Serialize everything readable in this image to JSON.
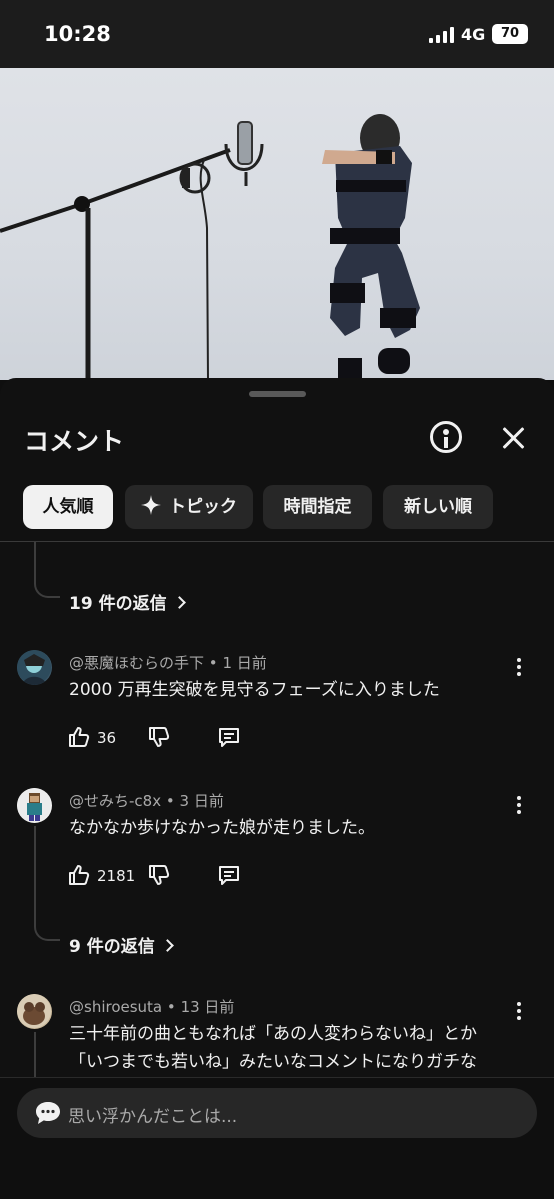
{
  "status_bar": {
    "time": "10:28",
    "network": "4G",
    "battery": "70"
  },
  "video": {
    "description_icon": "video-frame"
  },
  "comments_panel": {
    "title": "コメント",
    "chips": [
      {
        "label": "人気順",
        "selected": true
      },
      {
        "label": "トピック",
        "icon": "sparkle-icon",
        "selected": false
      },
      {
        "label": "時間指定",
        "selected": false
      },
      {
        "label": "新しい順",
        "selected": false
      }
    ],
    "top_replies_link": "19 件の返信",
    "comments": [
      {
        "author": "@悪魔ほむらの手下",
        "age": "1 日前",
        "text": "2000 万再生突破を見守るフェーズに入りました",
        "likes": "36"
      },
      {
        "author": "@せみち-c8x",
        "age": "3 日前",
        "text": "なかなか歩けなかった娘が走りました。",
        "likes": "2181",
        "replies": "9 件の返信"
      },
      {
        "author": "@shiroesuta",
        "age": "13 日前",
        "text_line1": "三十年前の曲ともなれば「あの人変わらないね」とか",
        "text_line2": "「いつまでも若いね」みたいなコメントになりガチな"
      }
    ],
    "separator": "•",
    "composer_placeholder": "思い浮かんだことは..."
  },
  "colors": {
    "background": "#0f0f0f",
    "chip": "#272727",
    "chip_active": "#f1f1f1",
    "secondary_text": "#aaaaaa"
  }
}
